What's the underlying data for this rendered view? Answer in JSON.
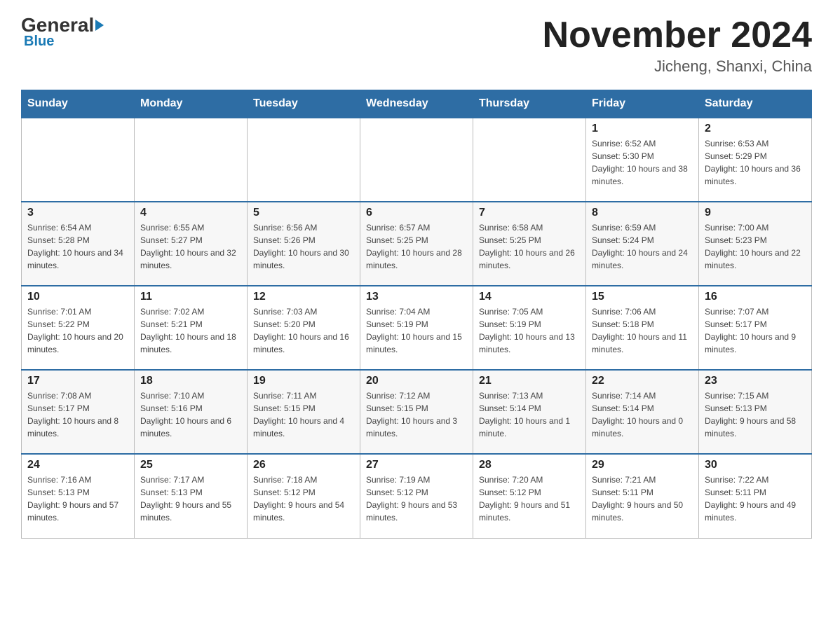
{
  "logo": {
    "part1": "General",
    "part2": "Blue"
  },
  "header": {
    "month_year": "November 2024",
    "location": "Jicheng, Shanxi, China"
  },
  "weekdays": [
    "Sunday",
    "Monday",
    "Tuesday",
    "Wednesday",
    "Thursday",
    "Friday",
    "Saturday"
  ],
  "weeks": [
    [
      {
        "day": "",
        "info": ""
      },
      {
        "day": "",
        "info": ""
      },
      {
        "day": "",
        "info": ""
      },
      {
        "day": "",
        "info": ""
      },
      {
        "day": "",
        "info": ""
      },
      {
        "day": "1",
        "info": "Sunrise: 6:52 AM\nSunset: 5:30 PM\nDaylight: 10 hours and 38 minutes."
      },
      {
        "day": "2",
        "info": "Sunrise: 6:53 AM\nSunset: 5:29 PM\nDaylight: 10 hours and 36 minutes."
      }
    ],
    [
      {
        "day": "3",
        "info": "Sunrise: 6:54 AM\nSunset: 5:28 PM\nDaylight: 10 hours and 34 minutes."
      },
      {
        "day": "4",
        "info": "Sunrise: 6:55 AM\nSunset: 5:27 PM\nDaylight: 10 hours and 32 minutes."
      },
      {
        "day": "5",
        "info": "Sunrise: 6:56 AM\nSunset: 5:26 PM\nDaylight: 10 hours and 30 minutes."
      },
      {
        "day": "6",
        "info": "Sunrise: 6:57 AM\nSunset: 5:25 PM\nDaylight: 10 hours and 28 minutes."
      },
      {
        "day": "7",
        "info": "Sunrise: 6:58 AM\nSunset: 5:25 PM\nDaylight: 10 hours and 26 minutes."
      },
      {
        "day": "8",
        "info": "Sunrise: 6:59 AM\nSunset: 5:24 PM\nDaylight: 10 hours and 24 minutes."
      },
      {
        "day": "9",
        "info": "Sunrise: 7:00 AM\nSunset: 5:23 PM\nDaylight: 10 hours and 22 minutes."
      }
    ],
    [
      {
        "day": "10",
        "info": "Sunrise: 7:01 AM\nSunset: 5:22 PM\nDaylight: 10 hours and 20 minutes."
      },
      {
        "day": "11",
        "info": "Sunrise: 7:02 AM\nSunset: 5:21 PM\nDaylight: 10 hours and 18 minutes."
      },
      {
        "day": "12",
        "info": "Sunrise: 7:03 AM\nSunset: 5:20 PM\nDaylight: 10 hours and 16 minutes."
      },
      {
        "day": "13",
        "info": "Sunrise: 7:04 AM\nSunset: 5:19 PM\nDaylight: 10 hours and 15 minutes."
      },
      {
        "day": "14",
        "info": "Sunrise: 7:05 AM\nSunset: 5:19 PM\nDaylight: 10 hours and 13 minutes."
      },
      {
        "day": "15",
        "info": "Sunrise: 7:06 AM\nSunset: 5:18 PM\nDaylight: 10 hours and 11 minutes."
      },
      {
        "day": "16",
        "info": "Sunrise: 7:07 AM\nSunset: 5:17 PM\nDaylight: 10 hours and 9 minutes."
      }
    ],
    [
      {
        "day": "17",
        "info": "Sunrise: 7:08 AM\nSunset: 5:17 PM\nDaylight: 10 hours and 8 minutes."
      },
      {
        "day": "18",
        "info": "Sunrise: 7:10 AM\nSunset: 5:16 PM\nDaylight: 10 hours and 6 minutes."
      },
      {
        "day": "19",
        "info": "Sunrise: 7:11 AM\nSunset: 5:15 PM\nDaylight: 10 hours and 4 minutes."
      },
      {
        "day": "20",
        "info": "Sunrise: 7:12 AM\nSunset: 5:15 PM\nDaylight: 10 hours and 3 minutes."
      },
      {
        "day": "21",
        "info": "Sunrise: 7:13 AM\nSunset: 5:14 PM\nDaylight: 10 hours and 1 minute."
      },
      {
        "day": "22",
        "info": "Sunrise: 7:14 AM\nSunset: 5:14 PM\nDaylight: 10 hours and 0 minutes."
      },
      {
        "day": "23",
        "info": "Sunrise: 7:15 AM\nSunset: 5:13 PM\nDaylight: 9 hours and 58 minutes."
      }
    ],
    [
      {
        "day": "24",
        "info": "Sunrise: 7:16 AM\nSunset: 5:13 PM\nDaylight: 9 hours and 57 minutes."
      },
      {
        "day": "25",
        "info": "Sunrise: 7:17 AM\nSunset: 5:13 PM\nDaylight: 9 hours and 55 minutes."
      },
      {
        "day": "26",
        "info": "Sunrise: 7:18 AM\nSunset: 5:12 PM\nDaylight: 9 hours and 54 minutes."
      },
      {
        "day": "27",
        "info": "Sunrise: 7:19 AM\nSunset: 5:12 PM\nDaylight: 9 hours and 53 minutes."
      },
      {
        "day": "28",
        "info": "Sunrise: 7:20 AM\nSunset: 5:12 PM\nDaylight: 9 hours and 51 minutes."
      },
      {
        "day": "29",
        "info": "Sunrise: 7:21 AM\nSunset: 5:11 PM\nDaylight: 9 hours and 50 minutes."
      },
      {
        "day": "30",
        "info": "Sunrise: 7:22 AM\nSunset: 5:11 PM\nDaylight: 9 hours and 49 minutes."
      }
    ]
  ]
}
